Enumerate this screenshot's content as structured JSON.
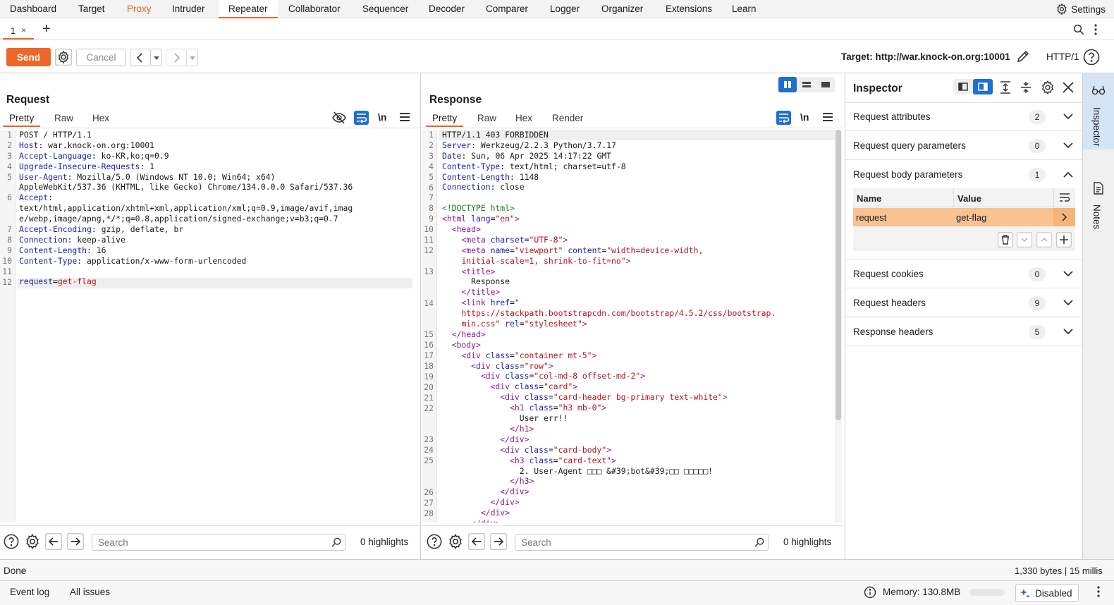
{
  "menu": {
    "items": [
      "Dashboard",
      "Target",
      "Proxy",
      "Intruder",
      "Repeater",
      "Collaborator",
      "Sequencer",
      "Decoder",
      "Comparer",
      "Logger",
      "Organizer",
      "Extensions",
      "Learn"
    ],
    "active": "Repeater",
    "settings_label": "Settings"
  },
  "tabs": {
    "current_label": "1",
    "close_glyph": "×",
    "add_glyph": "+"
  },
  "toolbar": {
    "send_label": "Send",
    "cancel_label": "Cancel",
    "target_label": "Target: http://war.knock-on.org:10001",
    "http_version": "HTTP/1"
  },
  "request": {
    "title": "Request",
    "tabs": [
      "Pretty",
      "Raw",
      "Hex"
    ],
    "newline_toggle": "\\n",
    "search_placeholder": "Search",
    "highlights": "0 highlights",
    "gutter": "1\n2\n3\n4\n5\n\n6\n\n\n7\n8\n9\n10\n11\n12",
    "lines": [
      [
        [
          "",
          "POST / HTTP/1.1"
        ]
      ],
      [
        [
          "hk",
          "Host"
        ],
        [
          "",
          ": war.knock-on.org:10001"
        ]
      ],
      [
        [
          "hk",
          "Accept-Language"
        ],
        [
          "",
          ": ko-KR,ko;q=0.9"
        ]
      ],
      [
        [
          "hk",
          "Upgrade-Insecure-Requests"
        ],
        [
          "",
          ": 1"
        ]
      ],
      [
        [
          "hk",
          "User-Agent"
        ],
        [
          "",
          ": Mozilla/5.0 (Windows NT 10.0; Win64; x64)"
        ]
      ],
      [
        [
          "",
          "AppleWebKit/537.36 (KHTML, like Gecko) Chrome/134.0.0.0 Safari/537.36"
        ]
      ],
      [
        [
          "hk",
          "Accept"
        ],
        [
          "",
          ":"
        ]
      ],
      [
        [
          "",
          "text/html,application/xhtml+xml,application/xml;q=0.9,image/avif,imag"
        ]
      ],
      [
        [
          "",
          "e/webp,image/apng,*/*;q=0.8,application/signed-exchange;v=b3;q=0.7"
        ]
      ],
      [
        [
          "hk",
          "Accept-Encoding"
        ],
        [
          "",
          ": gzip, deflate, br"
        ]
      ],
      [
        [
          "hk",
          "Connection"
        ],
        [
          "",
          ": keep-alive"
        ]
      ],
      [
        [
          "hk",
          "Content-Length"
        ],
        [
          "",
          ": 16"
        ]
      ],
      [
        [
          "hk",
          "Content-Type"
        ],
        [
          "",
          ": application/x-www-form-urlencoded"
        ]
      ],
      [
        [
          "",
          ""
        ]
      ],
      [
        [
          "hk",
          "request"
        ],
        [
          "",
          "="
        ],
        [
          "av",
          "get-flag"
        ]
      ]
    ]
  },
  "response": {
    "title": "Response",
    "tabs": [
      "Pretty",
      "Raw",
      "Hex",
      "Render"
    ],
    "newline_toggle": "\\n",
    "search_placeholder": "Search",
    "highlights": "0 highlights",
    "gutter": "1\n2\n3\n4\n5\n6\n7\n8\n9\n10\n11\n12\n\n13\n\n\n14\n\n\n15\n16\n17\n18\n19\n20\n21\n22\n\n\n23\n24\n25\n\n\n26\n27\n28",
    "lines": [
      [
        [
          "",
          "HTTP/1.1 403 FORBIDDEN"
        ]
      ],
      [
        [
          "hk",
          "Server"
        ],
        [
          "",
          ": Werkzeug/2.2.3 Python/3.7.17"
        ]
      ],
      [
        [
          "hk",
          "Date"
        ],
        [
          "",
          ": Sun, 06 Apr 2025 14:17:22 GMT"
        ]
      ],
      [
        [
          "hk",
          "Content-Type"
        ],
        [
          "",
          ": text/html; charset=utf-8"
        ]
      ],
      [
        [
          "hk",
          "Content-Length"
        ],
        [
          "",
          ": 1148"
        ]
      ],
      [
        [
          "hk",
          "Connection"
        ],
        [
          "",
          ": close"
        ]
      ],
      [
        [
          "",
          ""
        ]
      ],
      [
        [
          "cm",
          "<!DOCTYPE html>"
        ]
      ],
      [
        [
          "tg",
          "<html"
        ],
        [
          "hk",
          " lang"
        ],
        [
          "",
          "="
        ],
        [
          "av",
          "\"en\""
        ],
        [
          "tg",
          ">"
        ]
      ],
      [
        [
          "",
          "  "
        ],
        [
          "tg",
          "<head>"
        ]
      ],
      [
        [
          "",
          "    "
        ],
        [
          "tg",
          "<meta"
        ],
        [
          "hk",
          " charset"
        ],
        [
          "",
          "="
        ],
        [
          "av",
          "\"UTF-8\""
        ],
        [
          "tg",
          ">"
        ]
      ],
      [
        [
          "",
          "    "
        ],
        [
          "tg",
          "<meta"
        ],
        [
          "hk",
          " name"
        ],
        [
          "",
          "="
        ],
        [
          "av",
          "\"viewport\""
        ],
        [
          "hk",
          " content"
        ],
        [
          "",
          "="
        ],
        [
          "av",
          "\"width=device-width,"
        ]
      ],
      [
        [
          "",
          "    "
        ],
        [
          "av",
          "initial-scale=1, shrink-to-fit=no\""
        ],
        [
          "tg",
          ">"
        ]
      ],
      [
        [
          "",
          "    "
        ],
        [
          "tg",
          "<title>"
        ]
      ],
      [
        [
          "",
          "      Response"
        ]
      ],
      [
        [
          "",
          "    "
        ],
        [
          "tg",
          "</title>"
        ]
      ],
      [
        [
          "",
          "    "
        ],
        [
          "tg",
          "<link"
        ],
        [
          "hk",
          " href"
        ],
        [
          "",
          "="
        ],
        [
          "av",
          "\""
        ]
      ],
      [
        [
          "",
          "    "
        ],
        [
          "av",
          "https://stackpath.bootstrapcdn.com/bootstrap/4.5.2/css/bootstrap."
        ]
      ],
      [
        [
          "",
          "    "
        ],
        [
          "av",
          "min.css\""
        ],
        [
          "hk",
          " rel"
        ],
        [
          "",
          "="
        ],
        [
          "av",
          "\"stylesheet\""
        ],
        [
          "tg",
          ">"
        ]
      ],
      [
        [
          "",
          "  "
        ],
        [
          "tg",
          "</head>"
        ]
      ],
      [
        [
          "",
          "  "
        ],
        [
          "tg",
          "<body>"
        ]
      ],
      [
        [
          "",
          "    "
        ],
        [
          "tg",
          "<div"
        ],
        [
          "hk",
          " class"
        ],
        [
          "",
          "="
        ],
        [
          "av",
          "\"container mt-5\""
        ],
        [
          "tg",
          ">"
        ]
      ],
      [
        [
          "",
          "      "
        ],
        [
          "tg",
          "<div"
        ],
        [
          "hk",
          " class"
        ],
        [
          "",
          "="
        ],
        [
          "av",
          "\"row\""
        ],
        [
          "tg",
          ">"
        ]
      ],
      [
        [
          "",
          "        "
        ],
        [
          "tg",
          "<div"
        ],
        [
          "hk",
          " class"
        ],
        [
          "",
          "="
        ],
        [
          "av",
          "\"col-md-8 offset-md-2\""
        ],
        [
          "tg",
          ">"
        ]
      ],
      [
        [
          "",
          "          "
        ],
        [
          "tg",
          "<div"
        ],
        [
          "hk",
          " class"
        ],
        [
          "",
          "="
        ],
        [
          "av",
          "\"card\""
        ],
        [
          "tg",
          ">"
        ]
      ],
      [
        [
          "",
          "            "
        ],
        [
          "tg",
          "<div"
        ],
        [
          "hk",
          " class"
        ],
        [
          "",
          "="
        ],
        [
          "av",
          "\"card-header bg-primary text-white\""
        ],
        [
          "tg",
          ">"
        ]
      ],
      [
        [
          "",
          "              "
        ],
        [
          "tg",
          "<h1"
        ],
        [
          "hk",
          " class"
        ],
        [
          "",
          "="
        ],
        [
          "av",
          "\"h3 mb-0\""
        ],
        [
          "tg",
          ">"
        ]
      ],
      [
        [
          "",
          "                User err!!"
        ]
      ],
      [
        [
          "",
          "              "
        ],
        [
          "tg",
          "</h1>"
        ]
      ],
      [
        [
          "",
          "            "
        ],
        [
          "tg",
          "</div>"
        ]
      ],
      [
        [
          "",
          "            "
        ],
        [
          "tg",
          "<div"
        ],
        [
          "hk",
          " class"
        ],
        [
          "",
          "="
        ],
        [
          "av",
          "\"card-body\""
        ],
        [
          "tg",
          ">"
        ]
      ],
      [
        [
          "",
          "              "
        ],
        [
          "tg",
          "<h3"
        ],
        [
          "hk",
          " class"
        ],
        [
          "",
          "="
        ],
        [
          "av",
          "\"card-text\""
        ],
        [
          "tg",
          ">"
        ]
      ],
      [
        [
          "",
          "                2. User-Agent □□□ &#39;bot&#39;□□ □□□□□!"
        ]
      ],
      [
        [
          "",
          "              "
        ],
        [
          "tg",
          "</h3>"
        ]
      ],
      [
        [
          "",
          "            "
        ],
        [
          "tg",
          "</div>"
        ]
      ],
      [
        [
          "",
          "          "
        ],
        [
          "tg",
          "</div>"
        ]
      ],
      [
        [
          "",
          "        "
        ],
        [
          "tg",
          "</div>"
        ]
      ],
      [
        [
          "",
          "      "
        ],
        [
          "tg",
          "</div>"
        ]
      ]
    ]
  },
  "inspector": {
    "title": "Inspector",
    "sections": [
      {
        "label": "Request attributes",
        "count": "2"
      },
      {
        "label": "Request query parameters",
        "count": "0"
      },
      {
        "label": "Request body parameters",
        "count": "1"
      },
      {
        "label": "Request cookies",
        "count": "0"
      },
      {
        "label": "Request headers",
        "count": "9"
      },
      {
        "label": "Response headers",
        "count": "5"
      }
    ],
    "table_headers": [
      "Name",
      "Value"
    ],
    "param": {
      "name": "request",
      "value": "get-flag"
    }
  },
  "right_sidebar": {
    "inspector_label": "Inspector",
    "notes_label": "Notes"
  },
  "status": {
    "left": "Done",
    "right": "1,330 bytes | 15 millis"
  },
  "footer": {
    "event_log": "Event log",
    "all_issues": "All issues",
    "memory": "Memory: 130.8MB",
    "ai_state": "Disabled"
  },
  "colors": {
    "accent": "#ee6628",
    "active_blue": "#1f6fcf",
    "param_row": "#f8c291"
  }
}
